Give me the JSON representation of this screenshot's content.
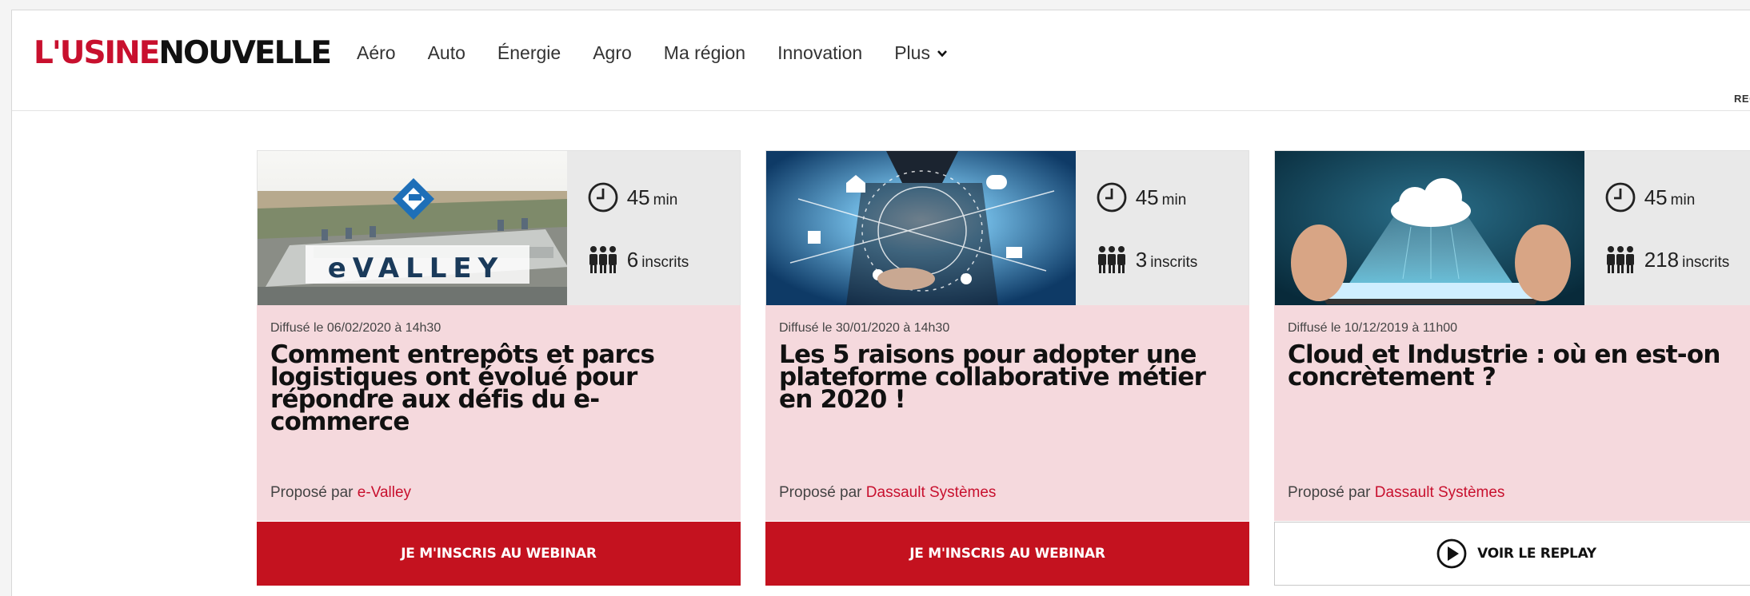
{
  "header": {
    "logo_part1": "L'USINE",
    "logo_part2": "NOUVELLE",
    "nav": [
      "Aéro",
      "Auto",
      "Énergie",
      "Agro",
      "Ma région",
      "Innovation"
    ],
    "more_label": "Plus",
    "right_text": "REC"
  },
  "cards": [
    {
      "duration": "45",
      "duration_unit": "min",
      "registrants": "6",
      "registrants_unit": "inscrits",
      "date": "Diffusé le 06/02/2020 à 14h30",
      "title": "Comment entrepôts et parcs logistiques ont évolué pour répondre aux défis du e-commerce",
      "provider_prefix": "Proposé par",
      "provider": "e-Valley",
      "thumb_text": "eVALLEY",
      "cta": "JE M'INSCRIS AU WEBINAR"
    },
    {
      "duration": "45",
      "duration_unit": "min",
      "registrants": "3",
      "registrants_unit": "inscrits",
      "date": "Diffusé le 30/01/2020 à 14h30",
      "title": "Les 5 raisons pour adopter une plateforme collaborative métier en 2020 !",
      "provider_prefix": "Proposé par",
      "provider": "Dassault Systèmes",
      "cta": "JE M'INSCRIS AU WEBINAR"
    },
    {
      "duration": "45",
      "duration_unit": "min",
      "registrants": "218",
      "registrants_unit": "inscrits",
      "date": "Diffusé le 10/12/2019 à 11h00",
      "title": "Cloud et Industrie : où en est-on concrètement ?",
      "provider_prefix": "Proposé par",
      "provider": "Dassault Systèmes",
      "cta": "VOIR LE REPLAY"
    }
  ],
  "colors": {
    "brand_red": "#c8102e",
    "card_body": "#f5d9dd",
    "stats_bg": "#e9e9e9"
  }
}
